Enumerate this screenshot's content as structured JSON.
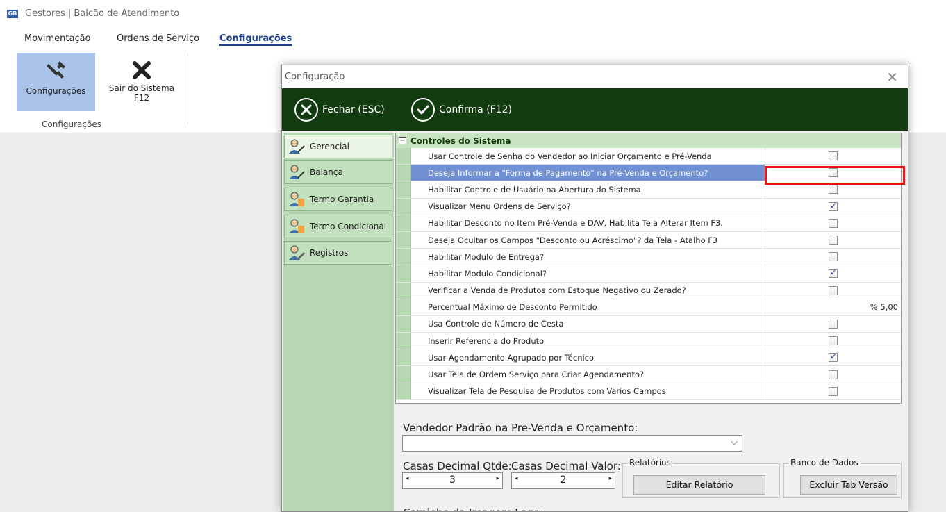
{
  "app": {
    "logo": "GB",
    "title": "Gestores | Balcão de Atendimento"
  },
  "menu": {
    "tabs": [
      "Movimentação",
      "Ordens de Serviço",
      "Configurações"
    ]
  },
  "ribbon": {
    "config_label": "Configurações",
    "exit_label_1": "Sair do Sistema",
    "exit_label_2": "F12",
    "group_label": "Configurações",
    "icons": {
      "config": "tools-icon",
      "exit": "close-x-icon"
    }
  },
  "dialog": {
    "title": "Configuração",
    "close_glyph": "✕",
    "close_label": "Fechar (ESC)",
    "confirm_label": "Confirma (F12)",
    "sidebar": [
      "Gerencial",
      "Balança",
      "Termo Garantia",
      "Termo Condicional",
      "Registros"
    ],
    "grid": {
      "group": "Controles do Sistema",
      "expander": "−",
      "rows": [
        {
          "label": "Usar Controle de Senha do Vendedor ao Iniciar Orçamento e Pré-Venda",
          "checked": false
        },
        {
          "label": "Deseja Informar a \"Forma de Pagamento\" na Pré-Venda e Orçamento?",
          "checked": false,
          "selected": true
        },
        {
          "label": "Habilitar Controle de Usuário na Abertura do Sistema",
          "checked": false
        },
        {
          "label": "Visualizar Menu Ordens de Serviço?",
          "checked": true
        },
        {
          "label": "Habilitar Desconto no Item Pré-Venda e DAV, Habilita Tela Alterar Item F3.",
          "checked": false
        },
        {
          "label": "Deseja Ocultar os Campos \"Desconto ou Acréscimo\"? da Tela - Atalho F3",
          "checked": false
        },
        {
          "label": "Habilitar Modulo de Entrega?",
          "checked": false
        },
        {
          "label": "Habilitar Modulo Condicional?",
          "checked": true
        },
        {
          "label": "Verificar a Venda de Produtos com Estoque Negativo ou Zerado?",
          "checked": false
        },
        {
          "label": "Percentual Máximo de Desconto Permitido",
          "value": "% 5,00"
        },
        {
          "label": "Usa Controle de Número de Cesta",
          "checked": false
        },
        {
          "label": "Inserir Referencia do Produto",
          "checked": false
        },
        {
          "label": "Usar Agendamento Agrupado por Técnico",
          "checked": true
        },
        {
          "label": "Usar Tela de Ordem Serviço para Criar Agendamento?",
          "checked": false
        },
        {
          "label": "Visualizar Tela de Pesquisa de Produtos com Varios Campos",
          "checked": false
        }
      ]
    },
    "form": {
      "vendor_label": "Vendedor Padrão na Pre-Venda e Orçamento:",
      "vendor_value": "",
      "qty_label": "Casas Decimal Qtde:",
      "qty_value": "3",
      "val_label": "Casas Decimal Valor:",
      "val_value": "2",
      "reports_legend": "Relatórios",
      "reports_button": "Editar Relatório",
      "db_legend": "Banco de Dados",
      "db_button": "Excluir Tab Versão",
      "logo_path_label": "Caminho da Imagem Logo:",
      "arrow_down": "⌵",
      "arrow_left": "◂",
      "arrow_right": "▸"
    }
  },
  "colors": {
    "toolbar": "#123b0f",
    "sidebar": "#b7d8b3",
    "selected_row": "#7191d3",
    "highlight": "#ee1111",
    "ribbon_selected": "#a9c4e8"
  }
}
